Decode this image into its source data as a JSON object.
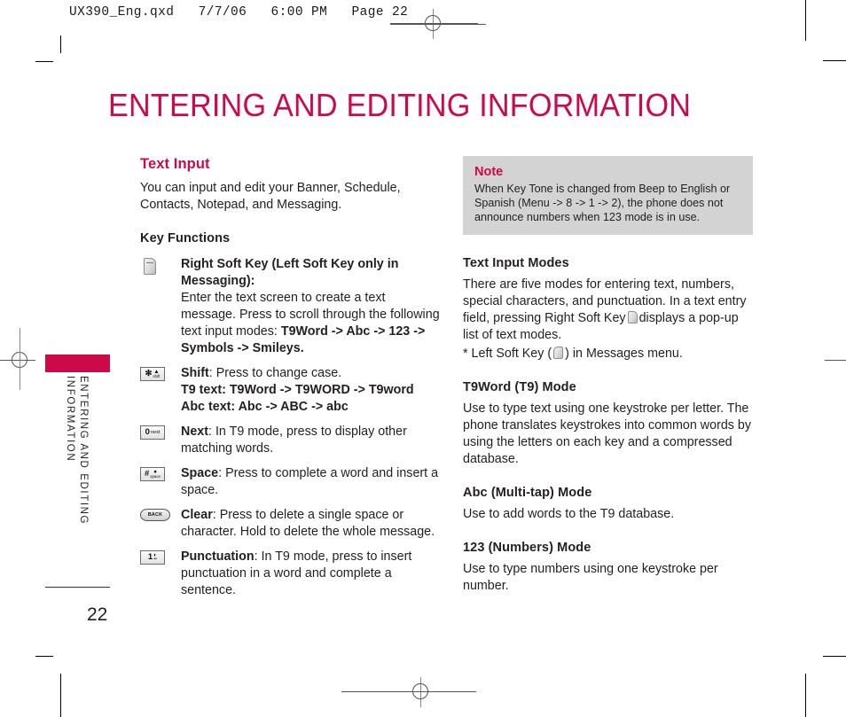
{
  "print": {
    "slug": "UX390_Eng.qxd   7/7/06   6:00 PM   Page 22"
  },
  "page": {
    "title": "ENTERING AND EDITING INFORMATION",
    "side_label": "ENTERING AND EDITING\nINFORMATION",
    "number": "22"
  },
  "left_column": {
    "section_title": "Text Input",
    "intro": "You can input and edit your Banner, Schedule, Contacts, Notepad, and Messaging.",
    "key_functions_heading": "Key Functions",
    "key_functions": [
      {
        "icon": "soft-key-icon",
        "icon_label": "",
        "title": "Right Soft Key (Left Soft Key only in Messaging):",
        "body": "Enter the text screen to create a text message. Press to scroll through the following text input modes:",
        "emphasis": "T9Word -> Abc -> 123 -> Symbols -> Smileys."
      },
      {
        "icon": "star-shift-key-icon",
        "icon_glyph": "✻",
        "icon_sub": "shift",
        "title": "Shift",
        "body": ": Press to change case.",
        "line2": "T9 text: T9Word -> T9WORD -> T9word",
        "line3": "Abc text: Abc -> ABC -> abc"
      },
      {
        "icon": "zero-next-key-icon",
        "icon_glyph": "0",
        "icon_sub": "next",
        "title": "Next",
        "body": ": In T9 mode, press to display other matching words."
      },
      {
        "icon": "hash-space-key-icon",
        "icon_glyph": "#",
        "icon_sub": "space",
        "title": "Space",
        "body": ": Press to complete a word and insert a space."
      },
      {
        "icon": "back-clear-key-icon",
        "icon_glyph": "BACK",
        "title": "Clear",
        "body": ": Press to delete a single space or character. Hold to delete the whole message."
      },
      {
        "icon": "one-punctuation-key-icon",
        "icon_glyph": "1",
        "icon_sub": "",
        "title": "Punctuation",
        "body": ": In T9 mode, press to insert punctuation in a word and complete a sentence."
      }
    ]
  },
  "right_column": {
    "note": {
      "heading": "Note",
      "body": "When Key Tone is changed from Beep to English or Spanish (Menu -> 8 -> 1 -> 2), the phone does not announce numbers when 123 mode is in use."
    },
    "sections": [
      {
        "heading": "Text Input Modes",
        "body_before_icon": "There are five modes for entering text, numbers, special characters, and punctuation. In a text entry field, pressing  Right Soft Key",
        "body_after_icon": "displays a pop-up list of text modes.",
        "footnote_before": "* Left Soft Key (",
        "footnote_after": ") in Messages menu."
      },
      {
        "heading": "T9Word (T9) Mode",
        "body": "Use to type text using one keystroke per letter. The phone translates keystrokes into common words by using the letters on each key and a compressed database."
      },
      {
        "heading": "Abc (Multi-tap) Mode",
        "body": "Use to add words to the T9 database."
      },
      {
        "heading": "123 (Numbers) Mode",
        "body": "Use to type numbers using one keystroke per number."
      }
    ]
  },
  "colors": {
    "accent": "#cc0a4a",
    "note_bg": "#d3d3d3",
    "text": "#231f20"
  }
}
